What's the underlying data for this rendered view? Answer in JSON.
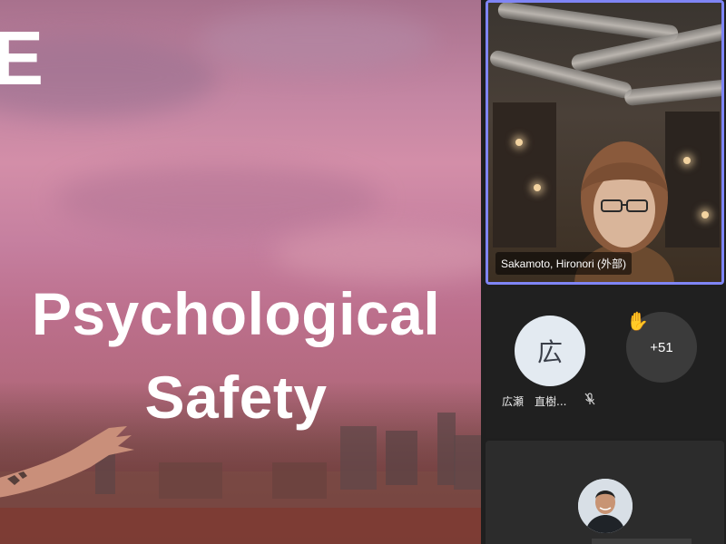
{
  "slide": {
    "partial_letter": "E",
    "title_line1": "Psychological",
    "title_line2": "Safety"
  },
  "video": {
    "participant_name": "Sakamoto, Hironori (外部)"
  },
  "participants": {
    "avatar_initial": "広",
    "avatar_name": "広瀬　直樹...",
    "more_count": "+51",
    "hand_raised_icon": "✋"
  },
  "colors": {
    "active_speaker_border": "#7f85f5",
    "panel_bg": "#1f1f1f"
  }
}
